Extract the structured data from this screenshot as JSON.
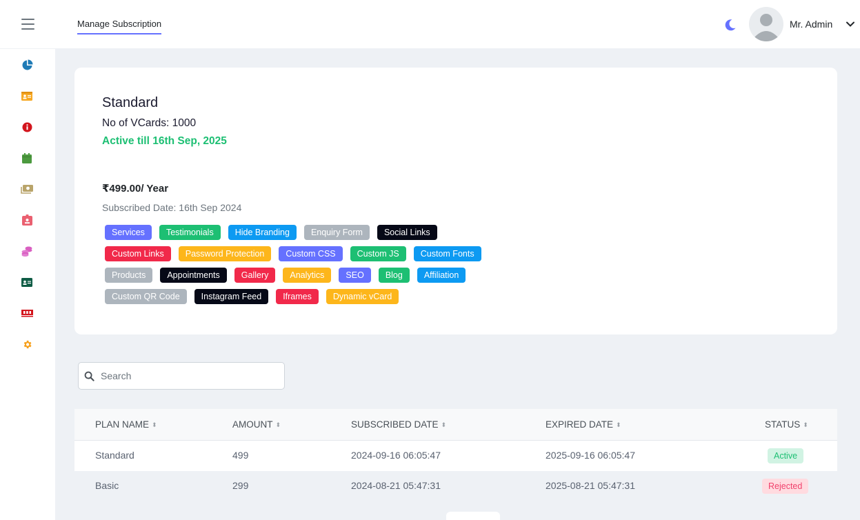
{
  "header": {
    "nav_tab": "Manage Subscription",
    "user_name": "Mr. Admin"
  },
  "sidebar": {
    "items": [
      {
        "icon": "pie-chart-icon",
        "color": "#1f7bb6"
      },
      {
        "icon": "id-card-icon",
        "color": "#f7a823"
      },
      {
        "icon": "info-circle-icon",
        "color": "#d3151d"
      },
      {
        "icon": "calendar-icon",
        "color": "#4c9a3f"
      },
      {
        "icon": "money-bill-icon",
        "color": "#b9a46a"
      },
      {
        "icon": "id-badge-icon",
        "color": "#ea6070"
      },
      {
        "icon": "coins-icon",
        "color": "#d95fc1"
      },
      {
        "icon": "address-card-icon",
        "color": "#0f5c45"
      },
      {
        "icon": "memory-icon",
        "color": "#d3151d"
      },
      {
        "icon": "gear-icon",
        "color": "#f7a01b"
      }
    ]
  },
  "plan": {
    "name": "Standard",
    "vcards": "No of VCards: 1000",
    "active_till": "Active till 16th Sep, 2025",
    "price": "₹499.00/ Year",
    "subscribed_date": "Subscribed Date: 16th Sep 2024",
    "features": [
      [
        {
          "label": "Services",
          "color": "#6571ff"
        },
        {
          "label": "Testimonials",
          "color": "#1dbf73"
        },
        {
          "label": "Hide Branding",
          "color": "#0d9af2"
        },
        {
          "label": "Enquiry Form",
          "color": "#adb5bd"
        },
        {
          "label": "Social Links",
          "color": "#060917"
        }
      ],
      [
        {
          "label": "Custom Links",
          "color": "#f1294a"
        },
        {
          "label": "Password Protection",
          "color": "#fdb61b"
        },
        {
          "label": "Custom CSS",
          "color": "#6571ff"
        },
        {
          "label": "Custom JS",
          "color": "#1dbf73"
        },
        {
          "label": "Custom Fonts",
          "color": "#0d9af2"
        }
      ],
      [
        {
          "label": "Products",
          "color": "#adb5bd"
        },
        {
          "label": "Appointments",
          "color": "#060917"
        },
        {
          "label": "Gallery",
          "color": "#f1294a"
        },
        {
          "label": "Analytics",
          "color": "#fdb61b"
        },
        {
          "label": "SEO",
          "color": "#6571ff"
        },
        {
          "label": "Blog",
          "color": "#1dbf73"
        },
        {
          "label": "Affiliation",
          "color": "#0d9af2"
        }
      ],
      [
        {
          "label": "Custom QR Code",
          "color": "#adb5bd"
        },
        {
          "label": "Instagram Feed",
          "color": "#060917"
        },
        {
          "label": "Iframes",
          "color": "#f1294a"
        },
        {
          "label": "Dynamic vCard",
          "color": "#fdb61b"
        }
      ]
    ]
  },
  "search": {
    "placeholder": "Search",
    "value": ""
  },
  "table": {
    "columns": [
      "PLAN NAME",
      "AMOUNT",
      "SUBSCRIBED DATE",
      "EXPIRED DATE",
      "STATUS"
    ],
    "rows": [
      {
        "plan": "Standard",
        "amount": "499",
        "subscribed": "2024-09-16 06:05:47",
        "expired": "2025-09-16 06:05:47",
        "status": "Active"
      },
      {
        "plan": "Basic",
        "amount": "299",
        "subscribed": "2024-08-21 05:47:31",
        "expired": "2025-08-21 05:47:31",
        "status": "Rejected"
      }
    ]
  }
}
